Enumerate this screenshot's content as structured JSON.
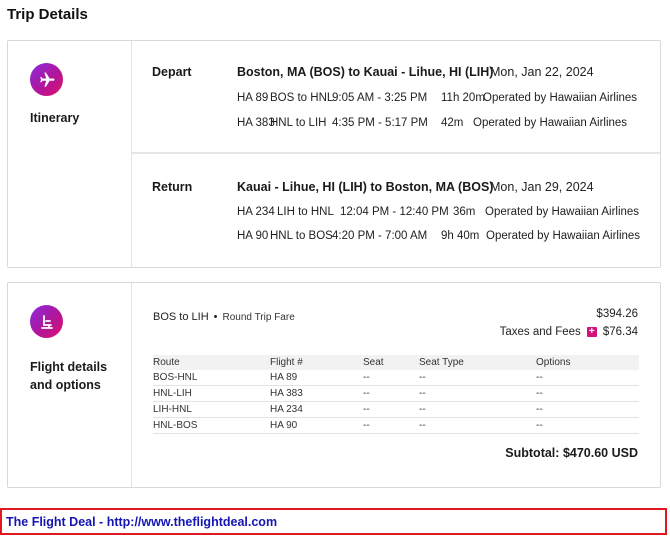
{
  "page": {
    "title": "Trip Details"
  },
  "itinerary": {
    "label": "Itinerary",
    "icon": "airplane-icon",
    "segments": [
      {
        "kind": "Depart",
        "route": "Boston, MA (BOS) to Kauai - Lihue, HI (LIH)",
        "date": "Mon, Jan 22, 2024",
        "legs": [
          {
            "flight": "HA 89",
            "route": "BOS to HNL",
            "times": "9:05 AM - 3:25 PM",
            "duration": "11h 20m",
            "operator": "Operated by Hawaiian Airlines"
          },
          {
            "flight": "HA 383",
            "route": "HNL to LIH",
            "times": "4:35 PM - 5:17 PM",
            "duration": "42m",
            "operator": "Operated by Hawaiian Airlines"
          }
        ]
      },
      {
        "kind": "Return",
        "route": "Kauai - Lihue, HI (LIH) to Boston, MA (BOS)",
        "date": "Mon, Jan 29, 2024",
        "legs": [
          {
            "flight": "HA 234",
            "route": "LIH to HNL",
            "times": "12:04 PM - 12:40 PM",
            "duration": "36m",
            "operator": "Operated by Hawaiian Airlines"
          },
          {
            "flight": "HA 90",
            "route": "HNL to BOS",
            "times": "4:20 PM - 7:00 AM",
            "duration": "9h 40m",
            "operator": "Operated by Hawaiian Airlines"
          }
        ]
      }
    ]
  },
  "details": {
    "label": "Flight details and options",
    "icon": "seat-icon",
    "fare_route": "BOS to LIH",
    "fare_type": "Round Trip Fare",
    "price": "$394.26",
    "taxes_label": "Taxes and Fees",
    "taxes_value": "$76.34",
    "plus_glyph": "+",
    "columns": [
      "Route",
      "Flight #",
      "Seat",
      "Seat Type",
      "Options"
    ],
    "rows": [
      [
        "BOS-HNL",
        "HA 89",
        "--",
        "--",
        "--"
      ],
      [
        "HNL-LIH",
        "HA 383",
        "--",
        "--",
        "--"
      ],
      [
        "LIH-HNL",
        "HA 234",
        "--",
        "--",
        "--"
      ],
      [
        "HNL-BOS",
        "HA 90",
        "--",
        "--",
        "--"
      ]
    ],
    "subtotal_label": "Subtotal:",
    "subtotal_value": "$470.60 USD"
  },
  "banner": {
    "text": "The Flight Deal - http://www.theflightdeal.com"
  },
  "colors": {
    "accent_start": "#8a2be2",
    "accent_end": "#e0106a",
    "banner_border": "#e0181f",
    "banner_text": "#1515b4"
  }
}
